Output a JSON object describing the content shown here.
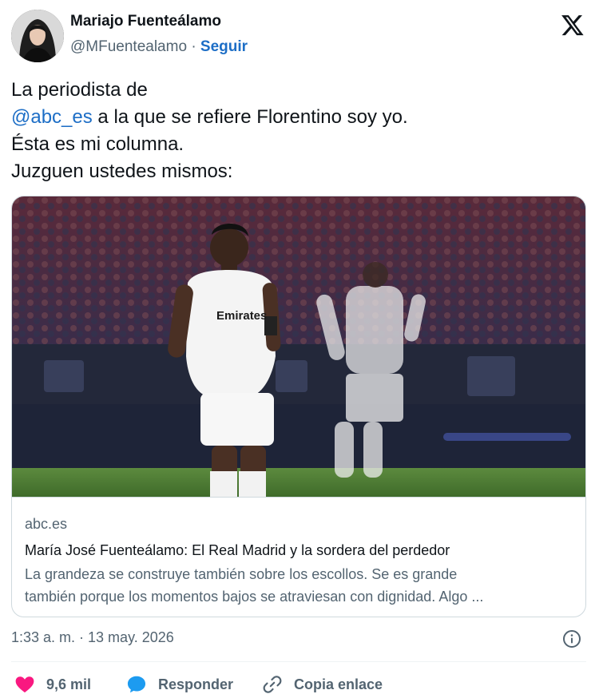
{
  "author": {
    "name": "Mariajo Fuenteálamo",
    "handle": "@MFuentealamo",
    "separator": "·",
    "follow_label": "Seguir"
  },
  "tweet": {
    "line1": "La periodista de",
    "mention": "@abc_es",
    "line2_rest": " a la que se refiere Florentino soy yo.",
    "line3": "Ésta es mi columna.",
    "line4": "Juzguen ustedes mismos:"
  },
  "card": {
    "domain": "abc.es",
    "title": "María José Fuenteálamo: El Real Madrid y la sordera del perdedor",
    "desc_line1": "La grandeza se construye también sobre los escollos. Se es grande",
    "desc_line2": "también porque los momentos bajos se atraviesan con dignidad. Algo ...",
    "image_icon": "football-photo",
    "jersey_text": "Emirates"
  },
  "meta": {
    "time": "1:33 a. m. · 13 may. 2026"
  },
  "actions": {
    "like_count": "9,6 mil",
    "reply_label": "Responder",
    "copy_label": "Copia enlace"
  },
  "icons": {
    "brand": "x-logo",
    "like": "heart-icon",
    "reply": "speech-bubble-icon",
    "copy": "link-icon",
    "info": "info-icon"
  },
  "colors": {
    "link": "#1d6ec6",
    "like": "#f91880",
    "reply": "#1d9bf0",
    "secondary_text": "#536471"
  }
}
